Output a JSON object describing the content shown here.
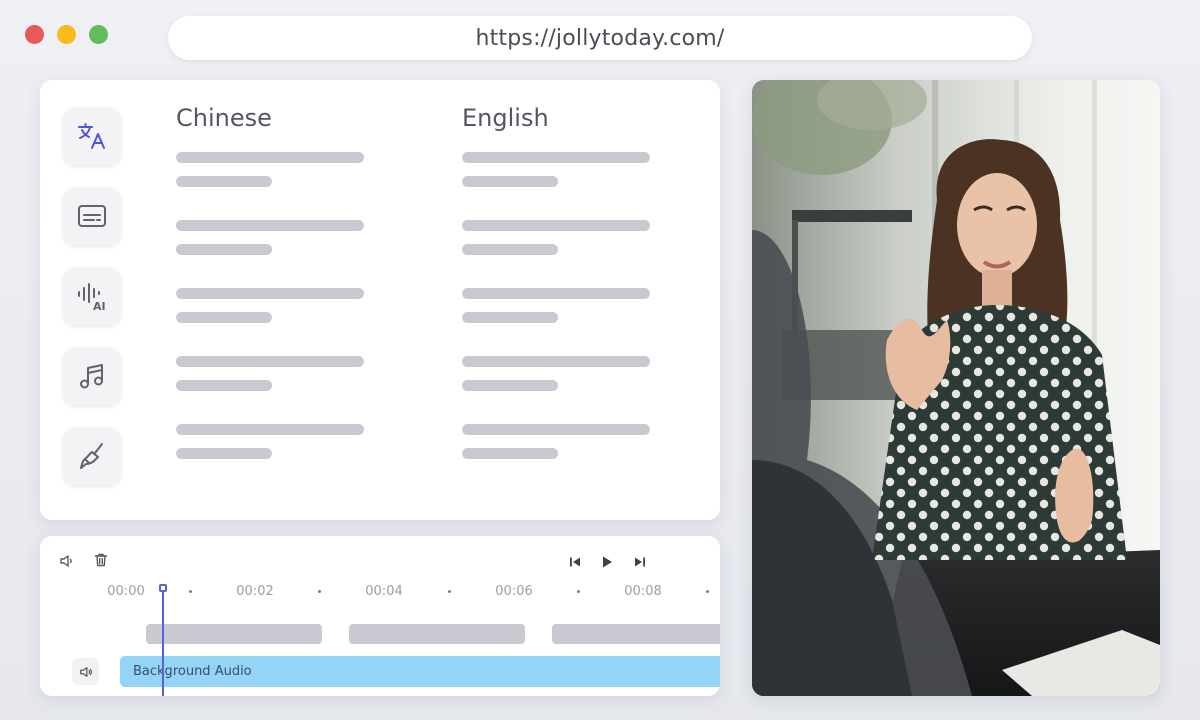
{
  "window": {
    "url": "https://jollytoday.com/",
    "controls": [
      "close",
      "minimize",
      "maximize"
    ]
  },
  "editor": {
    "tools": [
      {
        "name": "translate",
        "icon": "translate-icon"
      },
      {
        "name": "subtitles",
        "icon": "subtitles-icon"
      },
      {
        "name": "ai-voice",
        "icon": "ai-voice-icon"
      },
      {
        "name": "music",
        "icon": "music-icon"
      },
      {
        "name": "clean",
        "icon": "brush-icon"
      }
    ],
    "columns": {
      "source": "Chinese",
      "target": "English"
    },
    "rows_count": 5
  },
  "timeline": {
    "ticks": [
      "00:00",
      "00:02",
      "00:04",
      "00:06",
      "00:08"
    ],
    "audio_track_label": "Background Audio",
    "controls": [
      "volume",
      "delete",
      "skip-back",
      "play",
      "skip-forward"
    ]
  },
  "colors": {
    "accent": "#5b5fe0",
    "audio_track": "#93d4f7",
    "placeholder_bar": "#c9c9d1"
  }
}
